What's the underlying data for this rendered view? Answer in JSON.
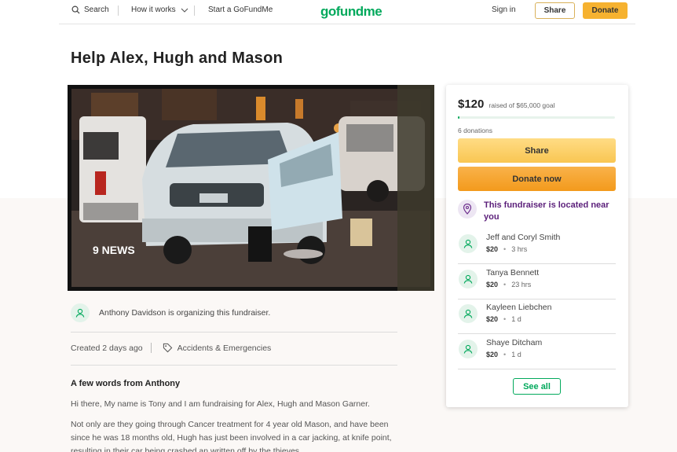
{
  "header": {
    "search_label": "Search",
    "how_label": "How it works",
    "start_label": "Start a GoFundMe",
    "logo": "gofundme",
    "signin_label": "Sign in",
    "share_label": "Share",
    "donate_label": "Donate"
  },
  "campaign": {
    "title": "Help Alex, Hugh and Mason",
    "organizer_text": "Anthony Davidson is organizing this fundraiser.",
    "created": "Created 2 days ago",
    "category": "Accidents & Emergencies",
    "story_heading": "A few words from Anthony",
    "story": [
      "Hi there, My name is Tony and I am fundraising for Alex, Hugh and Mason Garner.",
      "Not only are they going through Cancer treatment for 4 year old Mason, and have been since he was 18 months old, Hugh has just been involved in a car jacking, at knife point, resulting in their car being crashed an written off by the thieves."
    ]
  },
  "sidebar": {
    "raised_amount": "$120",
    "goal_text": "raised of $65,000 goal",
    "progress_fraction": 0.002,
    "donations_count": "6 donations",
    "share_label": "Share",
    "donate_label": "Donate now",
    "located_text": "This fundraiser is located near you",
    "donors": [
      {
        "name": "Jeff and Coryl Smith",
        "amount": "$20",
        "time": "3 hrs"
      },
      {
        "name": "Tanya Bennett",
        "amount": "$20",
        "time": "23 hrs"
      },
      {
        "name": "Kayleen Liebchen",
        "amount": "$20",
        "time": "1 d"
      },
      {
        "name": "Shaye Ditcham",
        "amount": "$20",
        "time": "1 d"
      }
    ],
    "see_all_label": "See all"
  },
  "hero_image": {
    "watermark": "9 NEWS"
  },
  "colors": {
    "brand_green": "#02a95c",
    "donate_orange": "#f39a1c",
    "share_yellow": "#f9c652",
    "location_purple": "#5b1f7a"
  }
}
